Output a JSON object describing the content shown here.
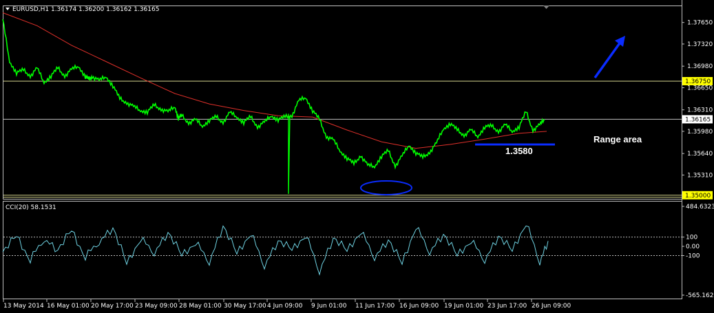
{
  "chart_data": [
    {
      "type": "line",
      "header": "EURUSD,H1  1.36174 1.36200 1.36162 1.36165",
      "ylim": [
        1.34945,
        1.379
      ],
      "grid": false,
      "colors": {
        "price": "#00ff00",
        "ma": "#e0302a",
        "annotation": "#0a2cff",
        "hline": "#d8d890"
      },
      "y_ticks": [
        "1.37650",
        "1.37320",
        "1.36980",
        "1.36650",
        "1.36310",
        "1.35980",
        "1.35640",
        "1.35310"
      ],
      "price_labels": [
        {
          "text": "1.36750",
          "value": 1.3675,
          "style": "yellow"
        },
        {
          "text": "1.36165",
          "value": 1.36165,
          "style": "white"
        },
        {
          "text": "1.35000",
          "value": 1.35,
          "style": "yellow"
        }
      ],
      "x_ticks": [
        "13 May 2014",
        "16 May 01:00",
        "20 May 17:00",
        "23 May 09:00",
        "28 May 01:00",
        "30 May 17:00",
        "4 Jun 09:00",
        "9 Jun 01:00",
        "11 Jun 17:00",
        "16 Jun 09:00",
        "19 Jun 01:00",
        "23 Jun 17:00",
        "26 Jun 09:00"
      ],
      "series": [
        {
          "kind": "price",
          "x": [
            0,
            10,
            20,
            30,
            40,
            50,
            60,
            70,
            80,
            90,
            100,
            110,
            120,
            125,
            130,
            140,
            150,
            160,
            170,
            180,
            190,
            200,
            210,
            220,
            230,
            240,
            250,
            255,
            260,
            270,
            280,
            290,
            300,
            310,
            320,
            330,
            340,
            350,
            360,
            370,
            380,
            390,
            400,
            410,
            420,
            430,
            440,
            450,
            460,
            470,
            480,
            490,
            500,
            510,
            520,
            530,
            540,
            550,
            560,
            570,
            580,
            590,
            600,
            610,
            620,
            630,
            640,
            650,
            660,
            670,
            680,
            690,
            700,
            710,
            720,
            730,
            740,
            750,
            760,
            770,
            780,
            787
          ],
          "values": [
            1.377,
            1.3705,
            1.3688,
            1.3692,
            1.3683,
            1.3695,
            1.3673,
            1.3683,
            1.3695,
            1.3683,
            1.3693,
            1.3698,
            1.3682,
            1.3678,
            1.3682,
            1.3676,
            1.3682,
            1.3668,
            1.3648,
            1.3642,
            1.3636,
            1.363,
            1.3628,
            1.3638,
            1.3632,
            1.3628,
            1.3636,
            1.3618,
            1.3622,
            1.3611,
            1.3616,
            1.3606,
            1.3615,
            1.362,
            1.3612,
            1.3627,
            1.362,
            1.3612,
            1.362,
            1.3605,
            1.3612,
            1.3622,
            1.3616,
            1.362,
            1.3622,
            1.3645,
            1.365,
            1.363,
            1.3616,
            1.359,
            1.3585,
            1.3568,
            1.3557,
            1.3548,
            1.3561,
            1.3546,
            1.3544,
            1.356,
            1.3568,
            1.3545,
            1.356,
            1.3577,
            1.3565,
            1.3558,
            1.3566,
            1.358,
            1.3602,
            1.361,
            1.36,
            1.3592,
            1.36,
            1.359,
            1.3605,
            1.3606,
            1.3598,
            1.3608,
            1.3598,
            1.3605,
            1.3628,
            1.36,
            1.3608,
            1.36165
          ]
        },
        {
          "kind": "ma",
          "x": [
            0,
            50,
            100,
            150,
            200,
            250,
            300,
            350,
            400,
            450,
            500,
            550,
            600,
            650,
            700,
            750,
            790
          ],
          "values": [
            1.378,
            1.376,
            1.373,
            1.3705,
            1.368,
            1.3656,
            1.364,
            1.363,
            1.3622,
            1.362,
            1.36,
            1.3582,
            1.3572,
            1.3578,
            1.3586,
            1.3595,
            1.3598
          ]
        },
        {
          "kind": "cci",
          "x": [
            0,
            20,
            40,
            60,
            80,
            100,
            120,
            140,
            160,
            180,
            200,
            220,
            240,
            260,
            280,
            300,
            320,
            340,
            360,
            380,
            400,
            420,
            440,
            460,
            480,
            500,
            520,
            540,
            560,
            580,
            600,
            620,
            640,
            660,
            680,
            700,
            720,
            740,
            760,
            780,
            792
          ],
          "values": [
            -60,
            120,
            -150,
            90,
            -40,
            180,
            -120,
            60,
            200,
            -180,
            80,
            -60,
            150,
            -90,
            40,
            -160,
            220,
            -70,
            140,
            -200,
            60,
            -30,
            120,
            -260,
            90,
            -40,
            160,
            -110,
            70,
            -180,
            210,
            -50,
            130,
            -90,
            60,
            -140,
            110,
            -40,
            250,
            -160,
            58.1531
          ]
        }
      ],
      "cci_panel": {
        "title": "CCI(20) 58.1531",
        "ylim": [
          -565.1622,
          484.6323
        ],
        "ticks": [
          "484.6323",
          "100",
          "0.00",
          "-100",
          "-565.1622"
        ],
        "levels": [
          100,
          -100
        ]
      },
      "annotations": {
        "level_label": "1.3580",
        "range_label": "Range area"
      }
    }
  ]
}
